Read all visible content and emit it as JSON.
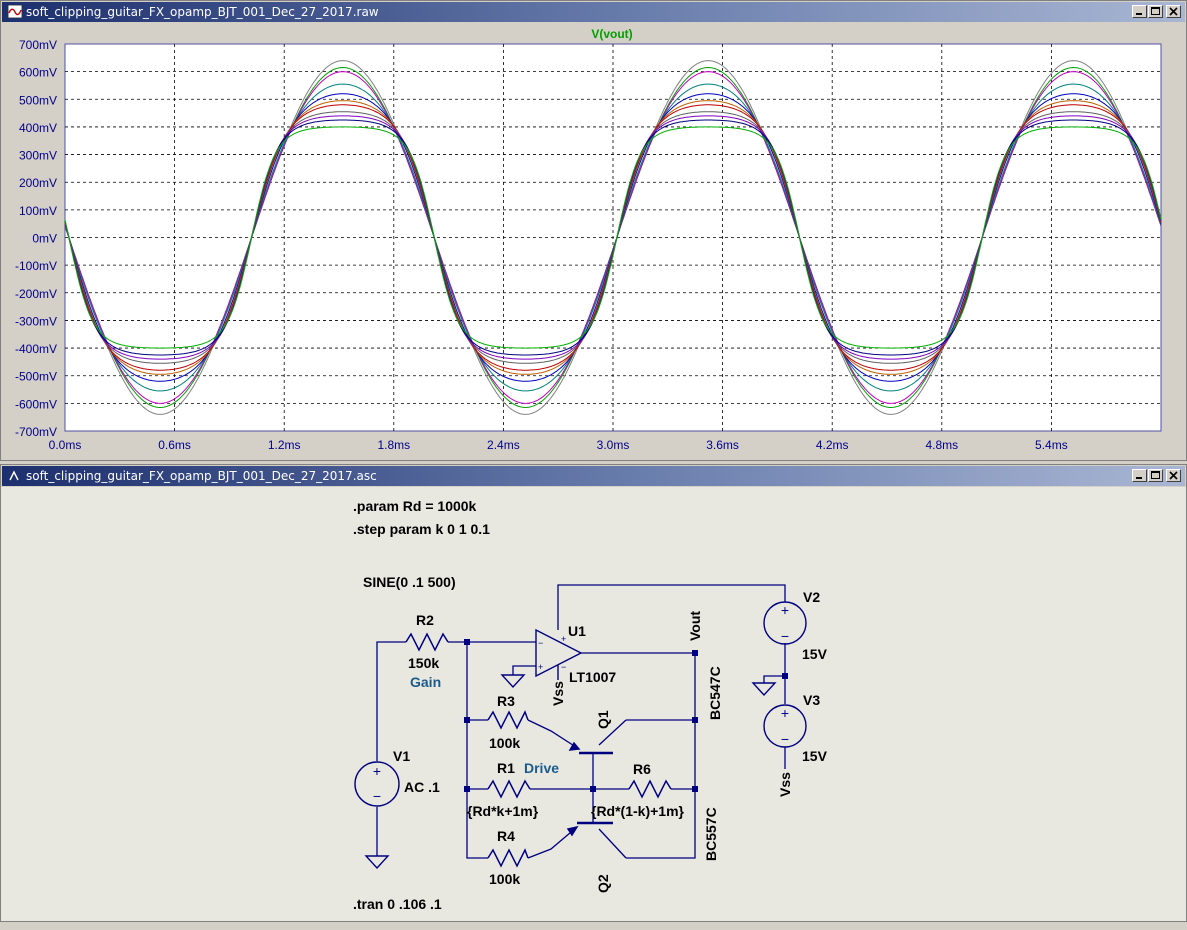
{
  "waveform_window": {
    "title": "soft_clipping_guitar_FX_opamp_BJT_001_Dec_27_2017.raw",
    "trace_label": "V(vout)"
  },
  "schematic_window": {
    "title": "soft_clipping_guitar_FX_opamp_BJT_001_Dec_27_2017.asc",
    "directives": {
      "param": ".param Rd = 1000k",
      "step": ".step param k 0 1 0.1",
      "tran": ".tran 0 .106 .1",
      "sine": "SINE(0 .1 500)"
    },
    "labels": {
      "r2": "R2",
      "r2_val": "150k",
      "gain": "Gain",
      "u1": "U1",
      "u1_model": "LT1007",
      "vout": "Vout",
      "vss_opamp": "Vss",
      "r3": "R3",
      "r3_val": "100k",
      "r1": "R1",
      "r1_val": "{Rd*k+1m}",
      "drive": "Drive",
      "r6": "R6",
      "r6_val": "{Rd*(1-k)+1m}",
      "r4": "R4",
      "r4_val": "100k",
      "q1": "Q1",
      "q1_model": "BC547C",
      "q2": "Q2",
      "q2_model": "BC557C",
      "v1": "V1",
      "v1_val": "AC .1",
      "v2": "V2",
      "v2_val": "15V",
      "v3": "V3",
      "v3_val": "15V",
      "vss_supply": "Vss"
    }
  },
  "colors": {
    "accent_blue": "#00008b",
    "trace_label": "#00a000",
    "title_left": "#1c2f6e",
    "net_label_blue": "#1c5a8c"
  },
  "chart_data": {
    "type": "line",
    "title": "V(vout)",
    "xlabel": "",
    "ylabel": "",
    "x_unit": "ms",
    "y_unit": "mV",
    "xlim": [
      0.0,
      6.0
    ],
    "ylim": [
      -700,
      700
    ],
    "x_ticks": [
      "0.0ms",
      "0.6ms",
      "1.2ms",
      "1.8ms",
      "2.4ms",
      "3.0ms",
      "3.6ms",
      "4.2ms",
      "4.8ms",
      "5.4ms"
    ],
    "y_ticks": [
      "700mV",
      "600mV",
      "500mV",
      "400mV",
      "300mV",
      "200mV",
      "100mV",
      "0mV",
      "-100mV",
      "-200mV",
      "-300mV",
      "-400mV",
      "-500mV",
      "-600mV",
      "-700mV"
    ],
    "grid": true,
    "signal": {
      "frequency_hz": 500,
      "start_ms": 0.0,
      "end_ms": 6.0,
      "start_value_mv": 40
    },
    "series": [
      {
        "peak_mv": 640,
        "color": "#808080"
      },
      {
        "peak_mv": 615,
        "color": "#00a000"
      },
      {
        "peak_mv": 600,
        "color": "#c000c0"
      },
      {
        "peak_mv": 555,
        "color": "#008080"
      },
      {
        "peak_mv": 520,
        "color": "#0000c0"
      },
      {
        "peak_mv": 495,
        "color": "#c06000"
      },
      {
        "peak_mv": 480,
        "color": "#c00000"
      },
      {
        "peak_mv": 455,
        "color": "#606060"
      },
      {
        "peak_mv": 440,
        "color": "#8000c0"
      },
      {
        "peak_mv": 425,
        "color": "#000080"
      },
      {
        "peak_mv": 400,
        "color": "#00b000"
      }
    ]
  }
}
